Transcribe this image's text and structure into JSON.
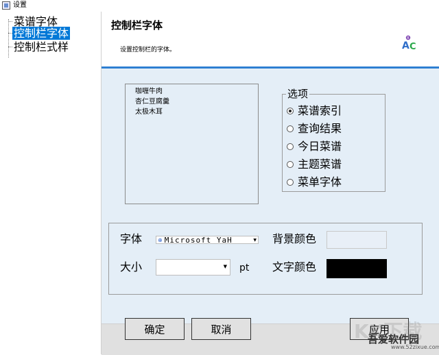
{
  "window": {
    "title": "设置"
  },
  "tree": {
    "items": [
      {
        "label": "菜谱字体",
        "selected": false
      },
      {
        "label": "控制栏字体",
        "selected": true
      },
      {
        "label": "控制栏式样",
        "selected": false
      }
    ]
  },
  "header": {
    "title": "控制栏字体",
    "subtitle": "设置控制栏的字体。",
    "logo_icon": "abc-font-icon"
  },
  "preview_list": {
    "items": [
      "咖喱牛肉",
      "杏仁豆腐羹",
      "太极木耳"
    ]
  },
  "options": {
    "legend": "选项",
    "items": [
      {
        "label": "菜谱索引",
        "checked": true
      },
      {
        "label": "查询结果",
        "checked": false
      },
      {
        "label": "今日菜谱",
        "checked": false
      },
      {
        "label": "主题菜谱",
        "checked": false
      },
      {
        "label": "菜单字体",
        "checked": false
      }
    ]
  },
  "font_settings": {
    "font_label": "字体",
    "font_value": "Microsoft YaH",
    "size_label": "大小",
    "size_value": "",
    "size_unit": "pt",
    "bg_color_label": "背景颜色",
    "bg_color": "#e8eff7",
    "text_color_label": "文字颜色",
    "text_color": "#000000"
  },
  "buttons": {
    "ok": "确定",
    "cancel": "取消",
    "apply": "应用"
  },
  "watermark": {
    "big": "KK下载",
    "name": "吾爱软件园",
    "url": "www.52zixue.com"
  },
  "colors": {
    "selection": "#0078d7",
    "header_rule": "#2e7fd2",
    "panel_bg": "#e4eef7"
  }
}
